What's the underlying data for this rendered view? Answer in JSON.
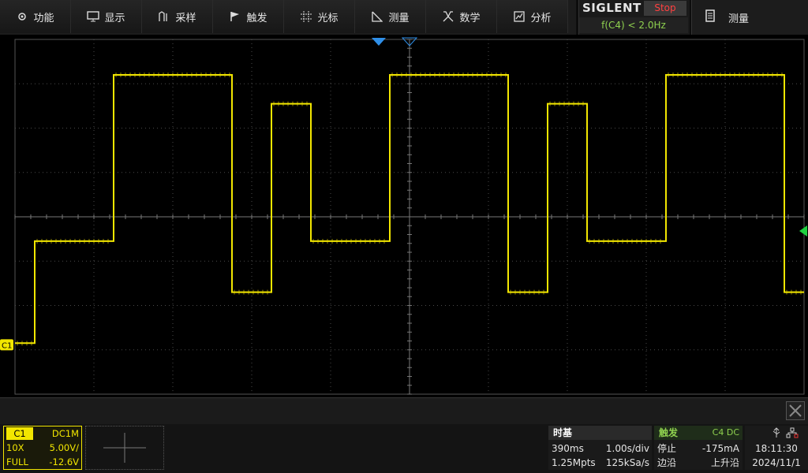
{
  "menu": [
    {
      "label": "功能",
      "icon": "gear-icon"
    },
    {
      "label": "显示",
      "icon": "monitor-icon"
    },
    {
      "label": "采样",
      "icon": "sampling-icon"
    },
    {
      "label": "触发",
      "icon": "trigger-flag-icon"
    },
    {
      "label": "光标",
      "icon": "cursor-crosshair-icon"
    },
    {
      "label": "测量",
      "icon": "measure-ruler-icon"
    },
    {
      "label": "数学",
      "icon": "math-icon"
    },
    {
      "label": "分析",
      "icon": "analysis-icon"
    }
  ],
  "brand": {
    "name": "SIGLENT",
    "run_state": "Stop",
    "trigger_readout": "f(C4) < 2.0Hz"
  },
  "measure_button": {
    "label": "测量",
    "icon": "measure-list-icon"
  },
  "channel": {
    "name": "C1",
    "coupling": "DC1M",
    "probe": "10X",
    "volts_div": "5.00V/",
    "bandwidth": "FULL",
    "offset": "-12.6V",
    "marker_label": "C1",
    "color": "#f2e600"
  },
  "timebase": {
    "title": "时基",
    "delay": "390ms",
    "time_div": "1.00s/div",
    "memory_depth": "1.25Mpts",
    "sample_rate": "125kSa/s"
  },
  "trigger": {
    "title": "触发",
    "source": "C4 DC",
    "state": "停止",
    "level": "-175mA",
    "type": "边沿",
    "slope": "上升沿"
  },
  "clock": {
    "time": "18:11:30",
    "date": "2024/11/1"
  },
  "colors": {
    "trace": "#f2e600",
    "grid": "#4a4a4a",
    "accent_green": "#8fd14f",
    "trigger_marker": "#2f8fe8",
    "level_marker": "#1fd140"
  },
  "waveform": {
    "grid_divisions": {
      "x": 10,
      "y": 8
    },
    "duration_s": 10,
    "levels_div": [
      -2.85,
      -0.55,
      3.2,
      1.75,
      -1.7
    ],
    "segments": [
      {
        "t_start_s": 0.0,
        "t_end_s": 0.5,
        "level_div": -2.85
      },
      {
        "t_start_s": 0.5,
        "t_end_s": 2.5,
        "level_div": -0.55
      },
      {
        "t_start_s": 2.5,
        "t_end_s": 5.5,
        "level_div": 3.2
      },
      {
        "t_start_s": 5.5,
        "t_end_s": 6.5,
        "level_div": -1.7
      },
      {
        "t_start_s": 6.5,
        "t_end_s": 7.5,
        "level_div": 3.2
      },
      {
        "t_start_s": 7.5,
        "t_end_s": 7.6,
        "level_div": 1.75
      },
      {
        "t_start_s": 7.6,
        "t_end_s": 8.5,
        "level_div": -0.55
      }
    ]
  }
}
